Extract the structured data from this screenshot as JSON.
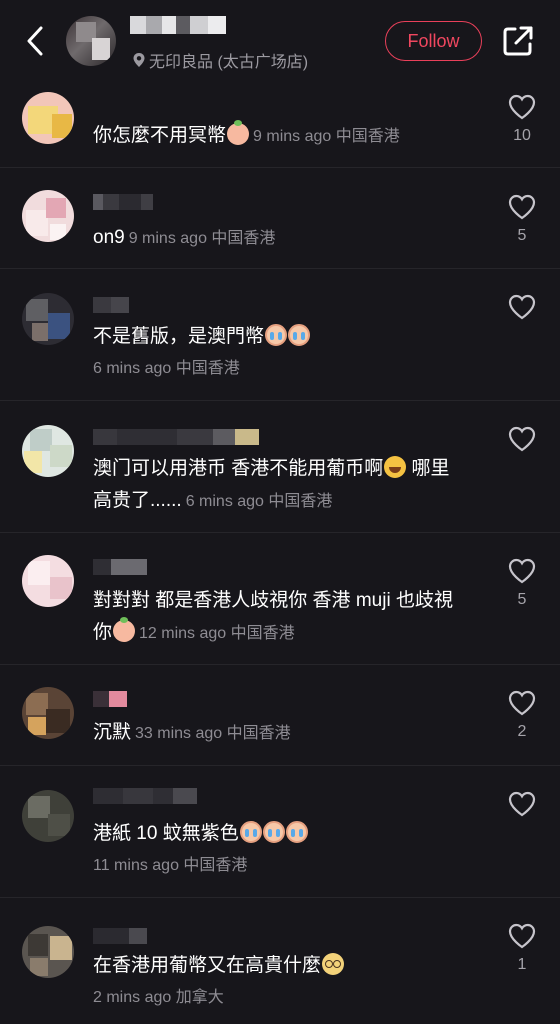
{
  "header": {
    "location": "无印良品 (太古广场店)",
    "follow_label": "Follow"
  },
  "comments": [
    {
      "text": "你怎麼不用冥幣",
      "emoji": [
        "peach"
      ],
      "meta": "9 mins ago 中国香港",
      "likes": "10"
    },
    {
      "text": "on9",
      "emoji": [],
      "meta": "9 mins ago 中国香港",
      "likes": "5"
    },
    {
      "text": "不是舊版，是澳門幣",
      "emoji": [
        "cry",
        "cry"
      ],
      "meta": "6 mins ago 中国香港",
      "likes": ""
    },
    {
      "text_line1": "澳门可以用港币 香港不能用葡币啊",
      "text_tail": " 哪里",
      "text_line2": "高贵了......",
      "emoji": [
        "laugh"
      ],
      "meta": "6 mins ago 中国香港",
      "likes": ""
    },
    {
      "text_line1": "對對對 都是香港人歧視你 香港 muji 也歧視",
      "text_line2": "你",
      "emoji": [
        "peach"
      ],
      "meta": "12 mins ago 中国香港",
      "likes": "5"
    },
    {
      "text": "沉默",
      "emoji": [],
      "meta": "33 mins ago 中国香港",
      "likes": "2"
    },
    {
      "text": "港紙 10 蚊無紫色",
      "emoji": [
        "cry",
        "cry",
        "cry"
      ],
      "meta": "11 mins ago 中国香港",
      "likes": ""
    },
    {
      "text": "在香港用葡幣又在高貴什麼",
      "emoji": [
        "glasses"
      ],
      "meta": "2 mins ago 加拿大",
      "likes": "1"
    }
  ]
}
